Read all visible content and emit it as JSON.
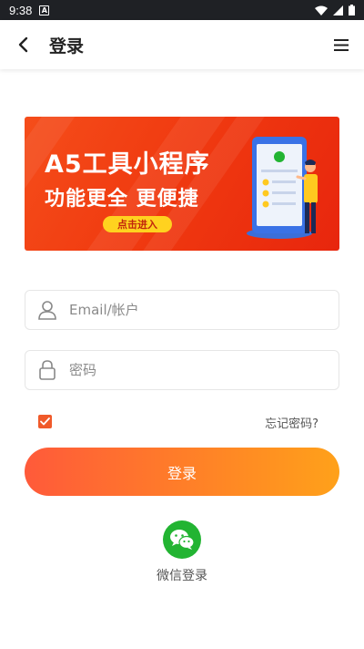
{
  "status_bar": {
    "time": "9:38",
    "notification_icon": "A"
  },
  "app_bar": {
    "title": "登录",
    "back_icon": "chevron-left-icon",
    "menu_icon": "hamburger-menu-icon"
  },
  "banner": {
    "title": "A5工具小程序",
    "subtitle": "功能更全  更便捷",
    "button_label": "点击进入",
    "accent_color": "#f03a10"
  },
  "form": {
    "account_placeholder": "Email/帐户",
    "account_value": "",
    "password_placeholder": "密码",
    "password_value": "",
    "remember_checked": true,
    "forgot_label": "忘记密码?",
    "login_label": "登录"
  },
  "social": {
    "wechat_label": "微信登录",
    "wechat_color": "#22b432"
  }
}
